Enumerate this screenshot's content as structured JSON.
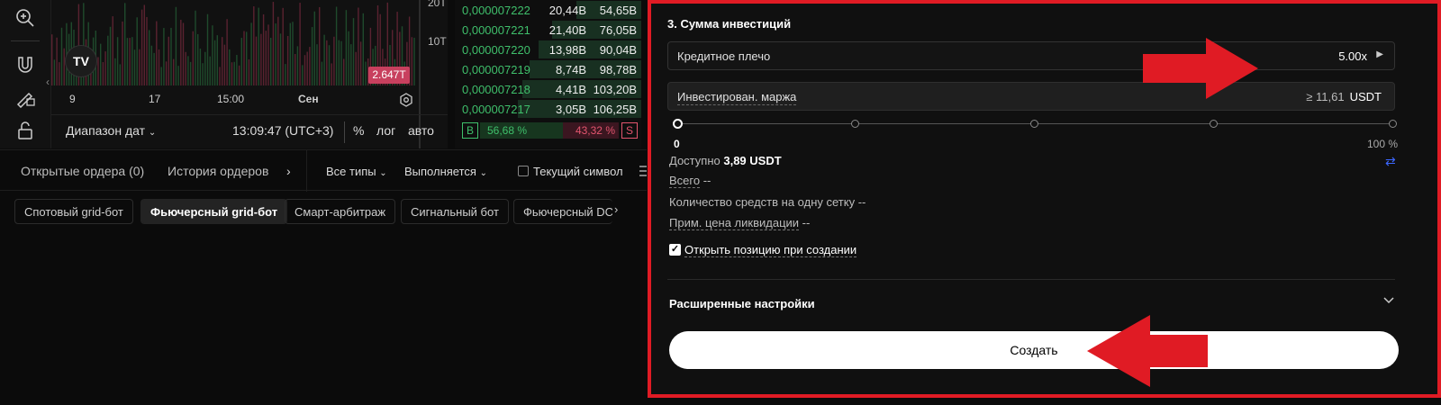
{
  "chart": {
    "y_labels": [
      "20T",
      "10T"
    ],
    "last_price": "2.647T",
    "x_labels": [
      "9",
      "17",
      "15:00",
      "Сен"
    ],
    "date_range": "Диапазон дат",
    "clock": "13:09:47 (UTC+3)",
    "percent": "%",
    "log": "лог",
    "auto": "авто",
    "logo": "TV"
  },
  "orderbook": {
    "rows": [
      {
        "price": "0,000007222",
        "volume": "20,44B",
        "total": "54,65B",
        "depth": 0.35
      },
      {
        "price": "0,000007221",
        "volume": "21,40B",
        "total": "76,05B",
        "depth": 0.48
      },
      {
        "price": "0,000007220",
        "volume": "13,98B",
        "total": "90,04B",
        "depth": 0.55
      },
      {
        "price": "0,000007219",
        "volume": "8,74B",
        "total": "98,78B",
        "depth": 0.6
      },
      {
        "price": "0,000007218",
        "volume": "4,41B",
        "total": "103,20B",
        "depth": 0.64
      },
      {
        "price": "0,000007217",
        "volume": "3,05B",
        "total": "106,25B",
        "depth": 0.66
      }
    ],
    "buy_letter": "B",
    "buy_pct": "56,68 %",
    "sell_pct": "43,32 %",
    "sell_letter": "S"
  },
  "tabs": {
    "open_orders": "Открытые ордера (0)",
    "history": "История ордеров",
    "more": "›",
    "type_filter": "Все типы",
    "status_filter": "Выполняется",
    "current_symbol": "Текущий символ"
  },
  "chips": [
    "Спотовый grid-бот",
    "Фьючерсный grid-бот",
    "Смарт-арбитраж",
    "Сигнальный бот",
    "Фьючерсный DC"
  ],
  "panel": {
    "title": "3. Сумма инвестиций",
    "leverage_label": "Кредитное плечо",
    "leverage_value": "5.00x",
    "margin_label": "Инвестирован. маржа",
    "margin_min": "≥ 11,61",
    "margin_unit": "USDT",
    "slider_min": "0",
    "slider_max": "100 %",
    "slider_value": 0,
    "available_label": "Доступно",
    "available_value": "3,89 USDT",
    "total_label": "Всего",
    "total_value": "--",
    "per_grid_label": "Количество средств на одну сетку",
    "per_grid_value": "--",
    "liq_label": "Прим. цена ликвидации",
    "liq_value": "--",
    "open_position_label": "Открыть позицию при создании",
    "open_position_checked": true,
    "advanced_label": "Расширенные настройки",
    "create_label": "Создать"
  },
  "colors": {
    "highlight_border": "#e01b24",
    "buy": "#3fbf6b",
    "sell": "#e3556e",
    "swap": "#3c67ff"
  }
}
